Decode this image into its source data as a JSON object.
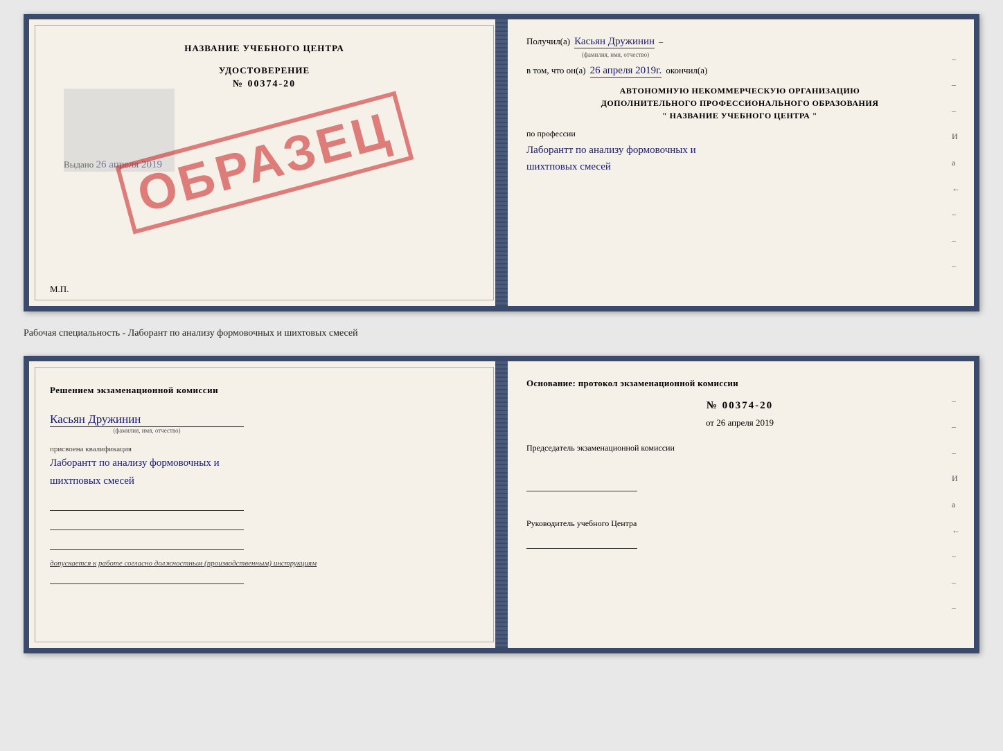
{
  "top_book": {
    "left": {
      "title": "НАЗВАНИЕ УЧЕБНОГО ЦЕНТРА",
      "cert_label": "УДОСТОВЕРЕНИЕ",
      "cert_number": "№ 00374-20",
      "issued_text": "Выдано",
      "issued_date": "26 апреля 2019",
      "mp_label": "М.П.",
      "stamp": "ОБРАЗЕЦ"
    },
    "right": {
      "received_label": "Получил(а)",
      "received_name": "Касьян Дружинин",
      "fio_sublabel": "(фамилия, имя, отчество)",
      "in_that_label": "в том, что он(а)",
      "completion_date": "26 апреля 2019г.",
      "finished_label": "окончил(а)",
      "org_line1": "АВТОНОМНУЮ НЕКОММЕРЧЕСКУЮ ОРГАНИЗАЦИЮ",
      "org_line2": "ДОПОЛНИТЕЛЬНОГО ПРОФЕССИОНАЛЬНОГО ОБРАЗОВАНИЯ",
      "org_line3": "\"   НАЗВАНИЕ УЧЕБНОГО ЦЕНТРА   \"",
      "profession_label": "по профессии",
      "profession_text": "Лаборантт по анализу формовочных и шихтповых смесей",
      "side_dashes": [
        "-",
        "-",
        "-",
        "И",
        "а",
        "←",
        "-",
        "-",
        "-"
      ]
    }
  },
  "specialty_label": "Рабочая специальность - Лаборант по анализу формовочных и шихтовых смесей",
  "bottom_book": {
    "left": {
      "decision_title": "Решением  экзаменационной  комиссии",
      "name": "Касьян  Дружинин",
      "fio_sublabel": "(фамилия, имя, отчество)",
      "qualification_label": "присвоена квалификация",
      "qualification_text": "Лаборантт по анализу формовочных и шихтповых смесей",
      "допускается_prefix": "допускается к",
      "допускается_underline": "работе согласно должностным (производственным) инструкциям"
    },
    "right": {
      "osnov_title": "Основание: протокол экзаменационной  комиссии",
      "protocol_number": "№  00374-20",
      "from_label": "от",
      "protocol_date": "26 апреля 2019",
      "chairman_label": "Председатель экзаменационной комиссии",
      "rukovoditel_label": "Руководитель учебного Центра",
      "side_dashes": [
        "-",
        "-",
        "-",
        "И",
        "а",
        "←",
        "-",
        "-",
        "-"
      ]
    }
  }
}
